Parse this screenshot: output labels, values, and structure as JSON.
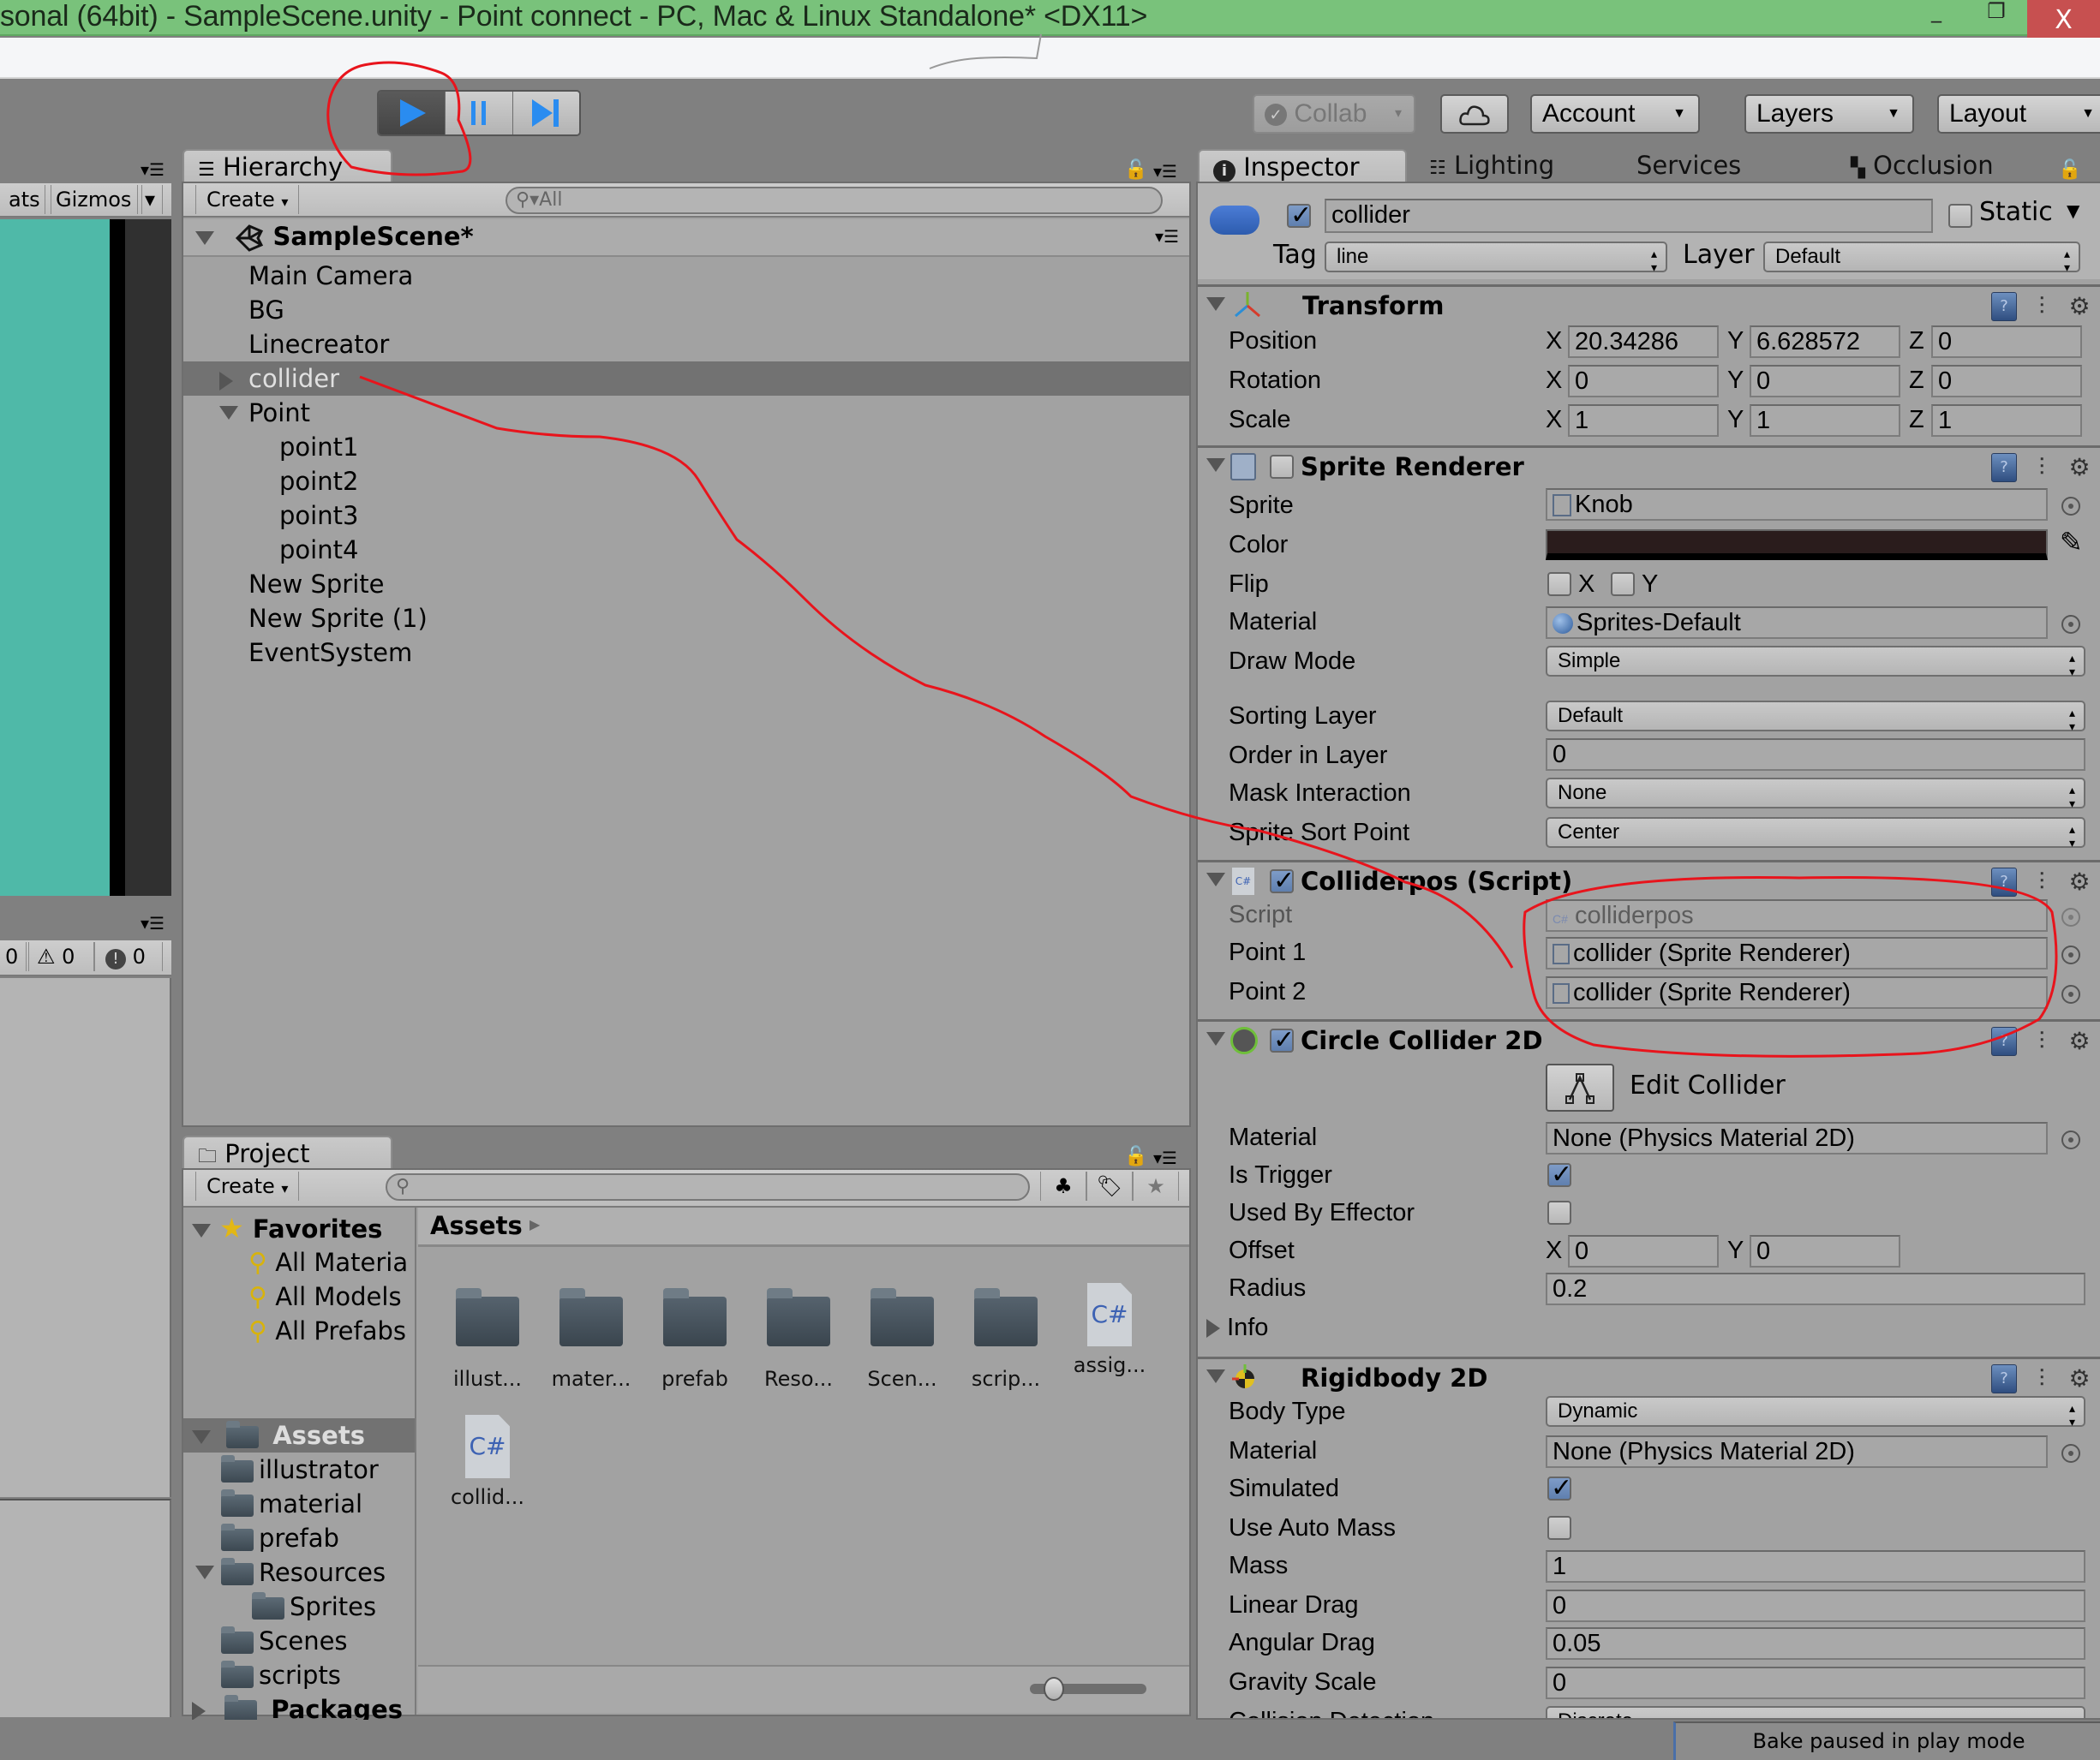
{
  "window": {
    "title": "sonal (64bit) - SampleScene.unity - Point connect - PC, Mac & Linux Standalone* <DX11>",
    "minimize": "_",
    "maximize": "❐",
    "close": "X"
  },
  "toolbar": {
    "play_icon": "play-icon",
    "pause_icon": "pause-icon",
    "step_icon": "step-icon",
    "collab": "Collab",
    "account": "Account",
    "layers": "Layers",
    "layout": "Layout"
  },
  "scene_view": {
    "stats_label": "ats",
    "gizmos_label": "Gizmos",
    "bg_color": "#4fb9a8"
  },
  "console": {
    "log_count": "0",
    "warning_count": "0",
    "error_count": "0"
  },
  "hierarchy": {
    "tab": "Hierarchy",
    "create": "Create",
    "search_placeholder": "All",
    "scene": "SampleScene*",
    "items": [
      {
        "label": "Main Camera",
        "depth": 1,
        "expander": "none",
        "selected": false
      },
      {
        "label": "BG",
        "depth": 1,
        "expander": "none",
        "selected": false
      },
      {
        "label": "Linecreator",
        "depth": 1,
        "expander": "none",
        "selected": false
      },
      {
        "label": "collider",
        "depth": 1,
        "expander": "collapsed",
        "selected": true
      },
      {
        "label": "Point",
        "depth": 1,
        "expander": "expanded",
        "selected": false
      },
      {
        "label": "point1",
        "depth": 2,
        "expander": "none",
        "selected": false
      },
      {
        "label": "point2",
        "depth": 2,
        "expander": "none",
        "selected": false
      },
      {
        "label": "point3",
        "depth": 2,
        "expander": "none",
        "selected": false
      },
      {
        "label": "point4",
        "depth": 2,
        "expander": "none",
        "selected": false
      },
      {
        "label": "New Sprite",
        "depth": 1,
        "expander": "none",
        "selected": false
      },
      {
        "label": "New Sprite (1)",
        "depth": 1,
        "expander": "none",
        "selected": false
      },
      {
        "label": "EventSystem",
        "depth": 1,
        "expander": "none",
        "selected": false
      }
    ]
  },
  "project": {
    "tab": "Project",
    "create": "Create",
    "search_placeholder": "",
    "breadcrumb": "Assets",
    "favorites_label": "Favorites",
    "favorites": [
      "All Materia",
      "All Models",
      "All Prefabs"
    ],
    "assets_label": "Assets",
    "tree": [
      {
        "label": "illustrator",
        "depth": 1,
        "expander": "none"
      },
      {
        "label": "material",
        "depth": 1,
        "expander": "none"
      },
      {
        "label": "prefab",
        "depth": 1,
        "expander": "none"
      },
      {
        "label": "Resources",
        "depth": 1,
        "expander": "expanded"
      },
      {
        "label": "Sprites",
        "depth": 2,
        "expander": "none"
      },
      {
        "label": "Scenes",
        "depth": 1,
        "expander": "none"
      },
      {
        "label": "scripts",
        "depth": 1,
        "expander": "none"
      }
    ],
    "packages_label": "Packages",
    "grid": [
      {
        "label": "illust...",
        "type": "folder"
      },
      {
        "label": "mater...",
        "type": "folder"
      },
      {
        "label": "prefab",
        "type": "folder"
      },
      {
        "label": "Reso...",
        "type": "folder"
      },
      {
        "label": "Scen...",
        "type": "folder"
      },
      {
        "label": "scrip...",
        "type": "folder"
      },
      {
        "label": "assig...",
        "type": "script"
      },
      {
        "label": "collid...",
        "type": "script"
      }
    ],
    "cs_glyph": "C#",
    "zoom_slider": 0.15
  },
  "inspector": {
    "tabs": [
      "Inspector",
      "Lighting",
      "Services",
      "Occlusion"
    ],
    "object": {
      "active": true,
      "name": "collider",
      "static_label": "Static",
      "static": false,
      "tag_label": "Tag",
      "tag": "line",
      "layer_label": "Layer",
      "layer": "Default"
    },
    "transform": {
      "title": "Transform",
      "rows": [
        {
          "label": "Position",
          "x": "20.34286",
          "y": "6.628572",
          "z": "0"
        },
        {
          "label": "Rotation",
          "x": "0",
          "y": "0",
          "z": "0"
        },
        {
          "label": "Scale",
          "x": "1",
          "y": "1",
          "z": "1"
        }
      ]
    },
    "sprite_renderer": {
      "title": "Sprite Renderer",
      "enabled": false,
      "sprite_label": "Sprite",
      "sprite": "Knob",
      "color_label": "Color",
      "color": "#2a1c1c",
      "flip_label": "Flip",
      "flip_x": false,
      "flip_y": false,
      "x": "X",
      "y": "Y",
      "material_label": "Material",
      "material": "Sprites-Default",
      "draw_mode_label": "Draw Mode",
      "draw_mode": "Simple",
      "sorting_layer_label": "Sorting Layer",
      "sorting_layer": "Default",
      "order_label": "Order in Layer",
      "order": "0",
      "mask_label": "Mask Interaction",
      "mask": "None",
      "sort_point_label": "Sprite Sort Point",
      "sort_point": "Center"
    },
    "script": {
      "title": "Colliderpos (Script)",
      "enabled": true,
      "script_label": "Script",
      "script": "colliderpos",
      "point1_label": "Point 1",
      "point1": "collider (Sprite Renderer)",
      "point2_label": "Point 2",
      "point2": "collider (Sprite Renderer)"
    },
    "circle_collider": {
      "title": "Circle Collider 2D",
      "enabled": true,
      "edit_collider": "Edit Collider",
      "material_label": "Material",
      "material": "None (Physics Material 2D)",
      "trigger_label": "Is Trigger",
      "is_trigger": true,
      "effector_label": "Used By Effector",
      "used_by_effector": false,
      "offset_label": "Offset",
      "offset_x": "0",
      "offset_y": "0",
      "radius_label": "Radius",
      "radius": "0.2",
      "info_label": "Info"
    },
    "rigidbody": {
      "title": "Rigidbody 2D",
      "body_type_label": "Body Type",
      "body_type": "Dynamic",
      "material_label": "Material",
      "material": "None (Physics Material 2D)",
      "simulated_label": "Simulated",
      "simulated": true,
      "auto_mass_label": "Use Auto Mass",
      "use_auto_mass": false,
      "mass_label": "Mass",
      "mass": "1",
      "linear_drag_label": "Linear Drag",
      "linear_drag": "0",
      "angular_drag_label": "Angular Drag",
      "angular_drag": "0.05",
      "gravity_label": "Gravity Scale",
      "gravity_scale": "0",
      "collision_label": "Collision Detection",
      "collision": "Discrete"
    }
  },
  "status_bar": {
    "message": "Bake paused in play mode"
  },
  "annotation_color": "#e8141c"
}
